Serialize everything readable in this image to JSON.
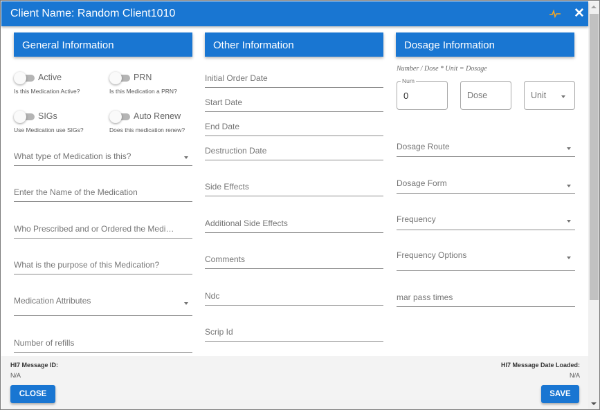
{
  "window": {
    "title": "Client Name: Random Client1010",
    "activity_icon": "pulse-icon",
    "close_icon": "close-icon",
    "close_glyph": "✕"
  },
  "sections": {
    "general": {
      "header": "General Information",
      "toggles": [
        {
          "label": "Active",
          "hint": "Is this Medication Active?",
          "on": false
        },
        {
          "label": "PRN",
          "hint": "Is this Medication a PRN?",
          "on": false
        },
        {
          "label": "SIGs",
          "hint": "Use Medication use SIGs?",
          "on": false
        },
        {
          "label": "Auto Renew",
          "hint": "Does this medication renew?",
          "on": false
        }
      ],
      "fields": [
        {
          "label": "What type of Medication is this?",
          "type": "select"
        },
        {
          "label": "Enter the Name of the Medication",
          "type": "text"
        },
        {
          "label": "Who Prescribed and or Ordered the Medication",
          "type": "text"
        },
        {
          "label": "What is the purpose of this Medication?",
          "type": "text"
        },
        {
          "label": "Medication Attributes",
          "type": "select"
        },
        {
          "label": "Number of refills",
          "type": "text"
        }
      ]
    },
    "other": {
      "header": "Other Information",
      "fields": [
        {
          "label": "Initial Order Date"
        },
        {
          "label": "Start Date"
        },
        {
          "label": "End Date"
        },
        {
          "label": "Destruction Date"
        },
        {
          "label": "Side Effects"
        },
        {
          "label": "Additional Side Effects"
        },
        {
          "label": "Comments"
        },
        {
          "label": "Ndc"
        },
        {
          "label": "Scrip Id"
        }
      ]
    },
    "dosage": {
      "header": "Dosage Information",
      "formula": "Number / Dose * Unit = Dosage",
      "num": {
        "legend": "Num",
        "value": "0"
      },
      "dose": {
        "placeholder": "Dose"
      },
      "unit": {
        "placeholder": "Unit"
      },
      "fields": [
        {
          "label": "Dosage Route",
          "type": "select"
        },
        {
          "label": "Dosage Form",
          "type": "select"
        },
        {
          "label": "Frequency",
          "type": "select"
        },
        {
          "label": "Frequency Options",
          "type": "select"
        },
        {
          "label": "mar pass times",
          "type": "text"
        }
      ]
    }
  },
  "footer": {
    "message_id_label": "HI7 Message ID:",
    "message_id_value": "N/A",
    "date_loaded_label": "HI7 Message Date Loaded:",
    "date_loaded_value": "N/A",
    "close_label": "CLOSE",
    "save_label": "SAVE"
  },
  "colors": {
    "primary": "#1976d2",
    "pulse_icon": "#f5a623",
    "footer_bg": "#f3f3f3"
  }
}
